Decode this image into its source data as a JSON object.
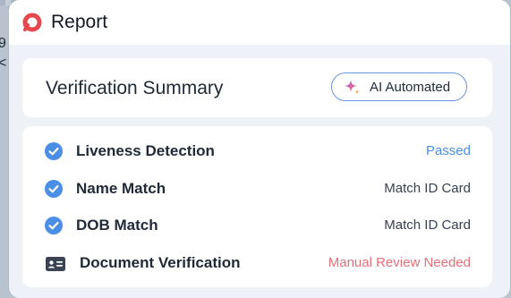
{
  "header": {
    "title": "Report"
  },
  "backdrop": {
    "line1": "9",
    "line2": "<"
  },
  "summary": {
    "title": "Verification Summary",
    "badge_label": "AI Automated",
    "badge_icon": "sparkle-icon"
  },
  "checks": [
    {
      "label": "Liveness Detection",
      "status": "Passed",
      "icon": "check-circle-icon"
    },
    {
      "label": "Name Match",
      "status": "Match ID Card",
      "icon": "check-circle-icon"
    },
    {
      "label": "DOB Match",
      "status": "Match ID Card",
      "icon": "check-circle-icon"
    },
    {
      "label": "Document Verification",
      "status": "Manual Review Needed",
      "icon": "id-card-icon"
    }
  ],
  "colors": {
    "brand": "#e5484d",
    "accent_blue": "#4a8ee6",
    "warning_red": "#e6707a"
  }
}
